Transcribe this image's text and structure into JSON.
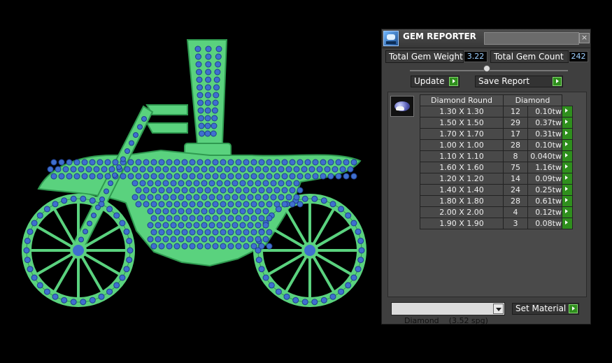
{
  "window": {
    "title": "GEM REPORTER",
    "close_label": "×"
  },
  "summary": {
    "total_weight_label": "Total Gem Weight",
    "total_weight_value": "3.22",
    "total_count_label": "Total Gem Count",
    "total_count_value": "242"
  },
  "buttons": {
    "update_label": "Update",
    "save_report_label": "Save Report",
    "set_material_label": "Set Material"
  },
  "report": {
    "shape_header": "Diamond Round",
    "material_header": "Diamond",
    "rows": [
      {
        "size": "1.30 X 1.30",
        "count": "12",
        "weight": "0.10tw"
      },
      {
        "size": "1.50 X 1.50",
        "count": "29",
        "weight": "0.37tw"
      },
      {
        "size": "1.70 X 1.70",
        "count": "17",
        "weight": "0.31tw"
      },
      {
        "size": "1.00 X 1.00",
        "count": "28",
        "weight": "0.10tw"
      },
      {
        "size": "1.10 X 1.10",
        "count": "8",
        "weight": "0.040tw"
      },
      {
        "size": "1.60 X 1.60",
        "count": "75",
        "weight": "1.16tw"
      },
      {
        "size": "1.20 X 1.20",
        "count": "14",
        "weight": "0.09tw"
      },
      {
        "size": "1.40 X 1.40",
        "count": "24",
        "weight": "0.25tw"
      },
      {
        "size": "1.80 X 1.80",
        "count": "28",
        "weight": "0.61tw"
      },
      {
        "size": "2.00 X 2.00",
        "count": "4",
        "weight": "0.12tw"
      },
      {
        "size": "1.90 X 1.90",
        "count": "3",
        "weight": "0.08tw"
      }
    ]
  },
  "material_select": {
    "value": "Diamond    (3.52 spg)"
  },
  "colors": {
    "metal": "#5fd882",
    "gem": "#3f6fcf",
    "background": "#000000",
    "panel": "#3f3f3f",
    "accent_green": "#2f8f1d"
  },
  "icons": [
    "app-icon",
    "close-icon",
    "arrow-right-icon",
    "gem-thumbnail-icon",
    "dropdown-icon"
  ]
}
